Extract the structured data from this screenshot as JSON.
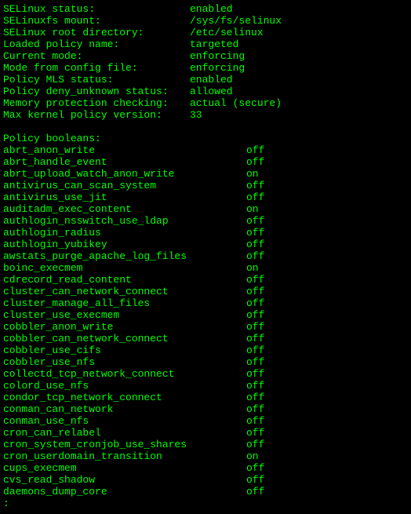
{
  "status": [
    {
      "label": "SELinux status:",
      "value": "enabled",
      "indent": false
    },
    {
      "label": "SELinuxfs mount:",
      "value": "/sys/fs/selinux",
      "indent": false
    },
    {
      "label": "SELinux root directory:",
      "value": "/etc/selinux",
      "indent": false
    },
    {
      "label": "Loaded policy name:",
      "value": "targeted",
      "indent": false
    },
    {
      "label": "Current mode:",
      "value": "enforcing",
      "indent": false
    },
    {
      "label": "Mode from config file:",
      "value": "enforcing",
      "indent": false
    },
    {
      "label": "Policy MLS status:",
      "value": "enabled",
      "indent": false
    },
    {
      "label": "Policy deny_unknown status:",
      "value": "allowed",
      "indent": false
    },
    {
      "label": "Memory protection checking:",
      "value": "actual (secure)",
      "indent": false
    },
    {
      "label": "Max kernel policy version:",
      "value": "33",
      "indent": false
    }
  ],
  "section_header": "Policy booleans:",
  "booleans": [
    {
      "name": "abrt_anon_write",
      "value": "off"
    },
    {
      "name": "abrt_handle_event",
      "value": "off"
    },
    {
      "name": "abrt_upload_watch_anon_write",
      "value": "on"
    },
    {
      "name": "antivirus_can_scan_system",
      "value": "off"
    },
    {
      "name": "antivirus_use_jit",
      "value": "off"
    },
    {
      "name": "auditadm_exec_content",
      "value": "on"
    },
    {
      "name": "authlogin_nsswitch_use_ldap",
      "value": "off"
    },
    {
      "name": "authlogin_radius",
      "value": "off"
    },
    {
      "name": "authlogin_yubikey",
      "value": "off"
    },
    {
      "name": "awstats_purge_apache_log_files",
      "value": "off"
    },
    {
      "name": "boinc_execmem",
      "value": "on"
    },
    {
      "name": "cdrecord_read_content",
      "value": "off"
    },
    {
      "name": "cluster_can_network_connect",
      "value": "off"
    },
    {
      "name": "cluster_manage_all_files",
      "value": "off"
    },
    {
      "name": "cluster_use_execmem",
      "value": "off"
    },
    {
      "name": "cobbler_anon_write",
      "value": "off"
    },
    {
      "name": "cobbler_can_network_connect",
      "value": "off"
    },
    {
      "name": "cobbler_use_cifs",
      "value": "off"
    },
    {
      "name": "cobbler_use_nfs",
      "value": "off"
    },
    {
      "name": "collectd_tcp_network_connect",
      "value": "off"
    },
    {
      "name": "colord_use_nfs",
      "value": "off"
    },
    {
      "name": "condor_tcp_network_connect",
      "value": "off"
    },
    {
      "name": "conman_can_network",
      "value": "off"
    },
    {
      "name": "conman_use_nfs",
      "value": "off"
    },
    {
      "name": "cron_can_relabel",
      "value": "off"
    },
    {
      "name": "cron_system_cronjob_use_shares",
      "value": "off"
    },
    {
      "name": "cron_userdomain_transition",
      "value": "on"
    },
    {
      "name": "cups_execmem",
      "value": "off"
    },
    {
      "name": "cvs_read_shadow",
      "value": "off"
    },
    {
      "name": "daemons_dump_core",
      "value": "off"
    }
  ],
  "prompt": ":"
}
